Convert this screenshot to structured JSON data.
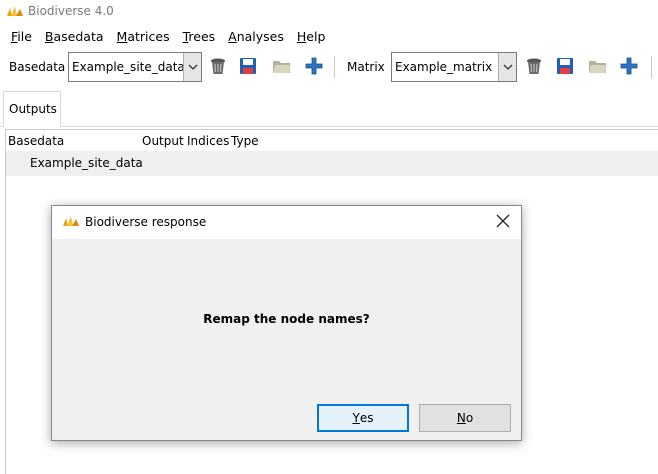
{
  "window": {
    "title": "Biodiverse 4.0"
  },
  "menu": [
    {
      "label": "File",
      "accel": "F",
      "rest": "ile"
    },
    {
      "label": "Basedata",
      "accel": "B",
      "rest": "asedata"
    },
    {
      "label": "Matrices",
      "accel": "M",
      "rest": "atrices"
    },
    {
      "label": "Trees",
      "accel": "T",
      "rest": "rees"
    },
    {
      "label": "Analyses",
      "accel": "A",
      "rest": "nalyses"
    },
    {
      "label": "Help",
      "accel": "H",
      "rest": "elp"
    }
  ],
  "toolbar": {
    "basedata_label": "Basedata",
    "basedata_value": "Example_site_data",
    "matrix_label": "Matrix",
    "matrix_value": "Example_matrix",
    "icons": [
      "delete-icon",
      "save-icon",
      "open-folder-icon",
      "add-icon"
    ]
  },
  "tabs": [
    {
      "label": "Outputs"
    }
  ],
  "table": {
    "columns": [
      "Basedata",
      "Output",
      "Indices",
      "Type"
    ],
    "rows": [
      {
        "basedata": "Example_site_data"
      }
    ]
  },
  "dialog": {
    "title": "Biodiverse response",
    "message": "Remap the node names?",
    "yes_accel": "Y",
    "yes_rest": "es",
    "no_accel": "N",
    "no_rest": "o"
  },
  "colors": {
    "focus_border": "#0078d7",
    "dialog_bg": "#f0f0f0",
    "row_bg": "#efefef"
  }
}
